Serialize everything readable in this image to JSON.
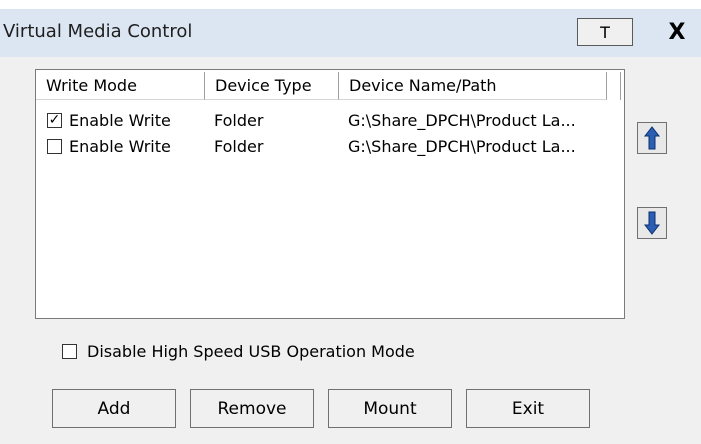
{
  "window": {
    "title": "Virtual Media Control",
    "pin_label": "T",
    "close_label": "X"
  },
  "list": {
    "columns": [
      "Write Mode",
      "Device Type",
      "Device Name/Path"
    ],
    "rows": [
      {
        "checked": true,
        "write_mode": "Enable Write",
        "device_type": "Folder",
        "device_path": "G:\\Share_DPCH\\Product La..."
      },
      {
        "checked": false,
        "write_mode": "Enable Write",
        "device_type": "Folder",
        "device_path": "G:\\Share_DPCH\\Product La..."
      }
    ],
    "check_mark": "✓"
  },
  "side_buttons": {
    "up_icon": "arrow-up-icon",
    "down_icon": "arrow-down-icon"
  },
  "options": {
    "disable_high_speed_label": "Disable High Speed USB Operation Mode",
    "disable_high_speed_checked": false
  },
  "buttons": {
    "add": "Add",
    "remove": "Remove",
    "mount": "Mount",
    "exit": "Exit"
  },
  "colors": {
    "titlebar": "#dce6f2",
    "arrow_blue": "#2b5fb3"
  }
}
